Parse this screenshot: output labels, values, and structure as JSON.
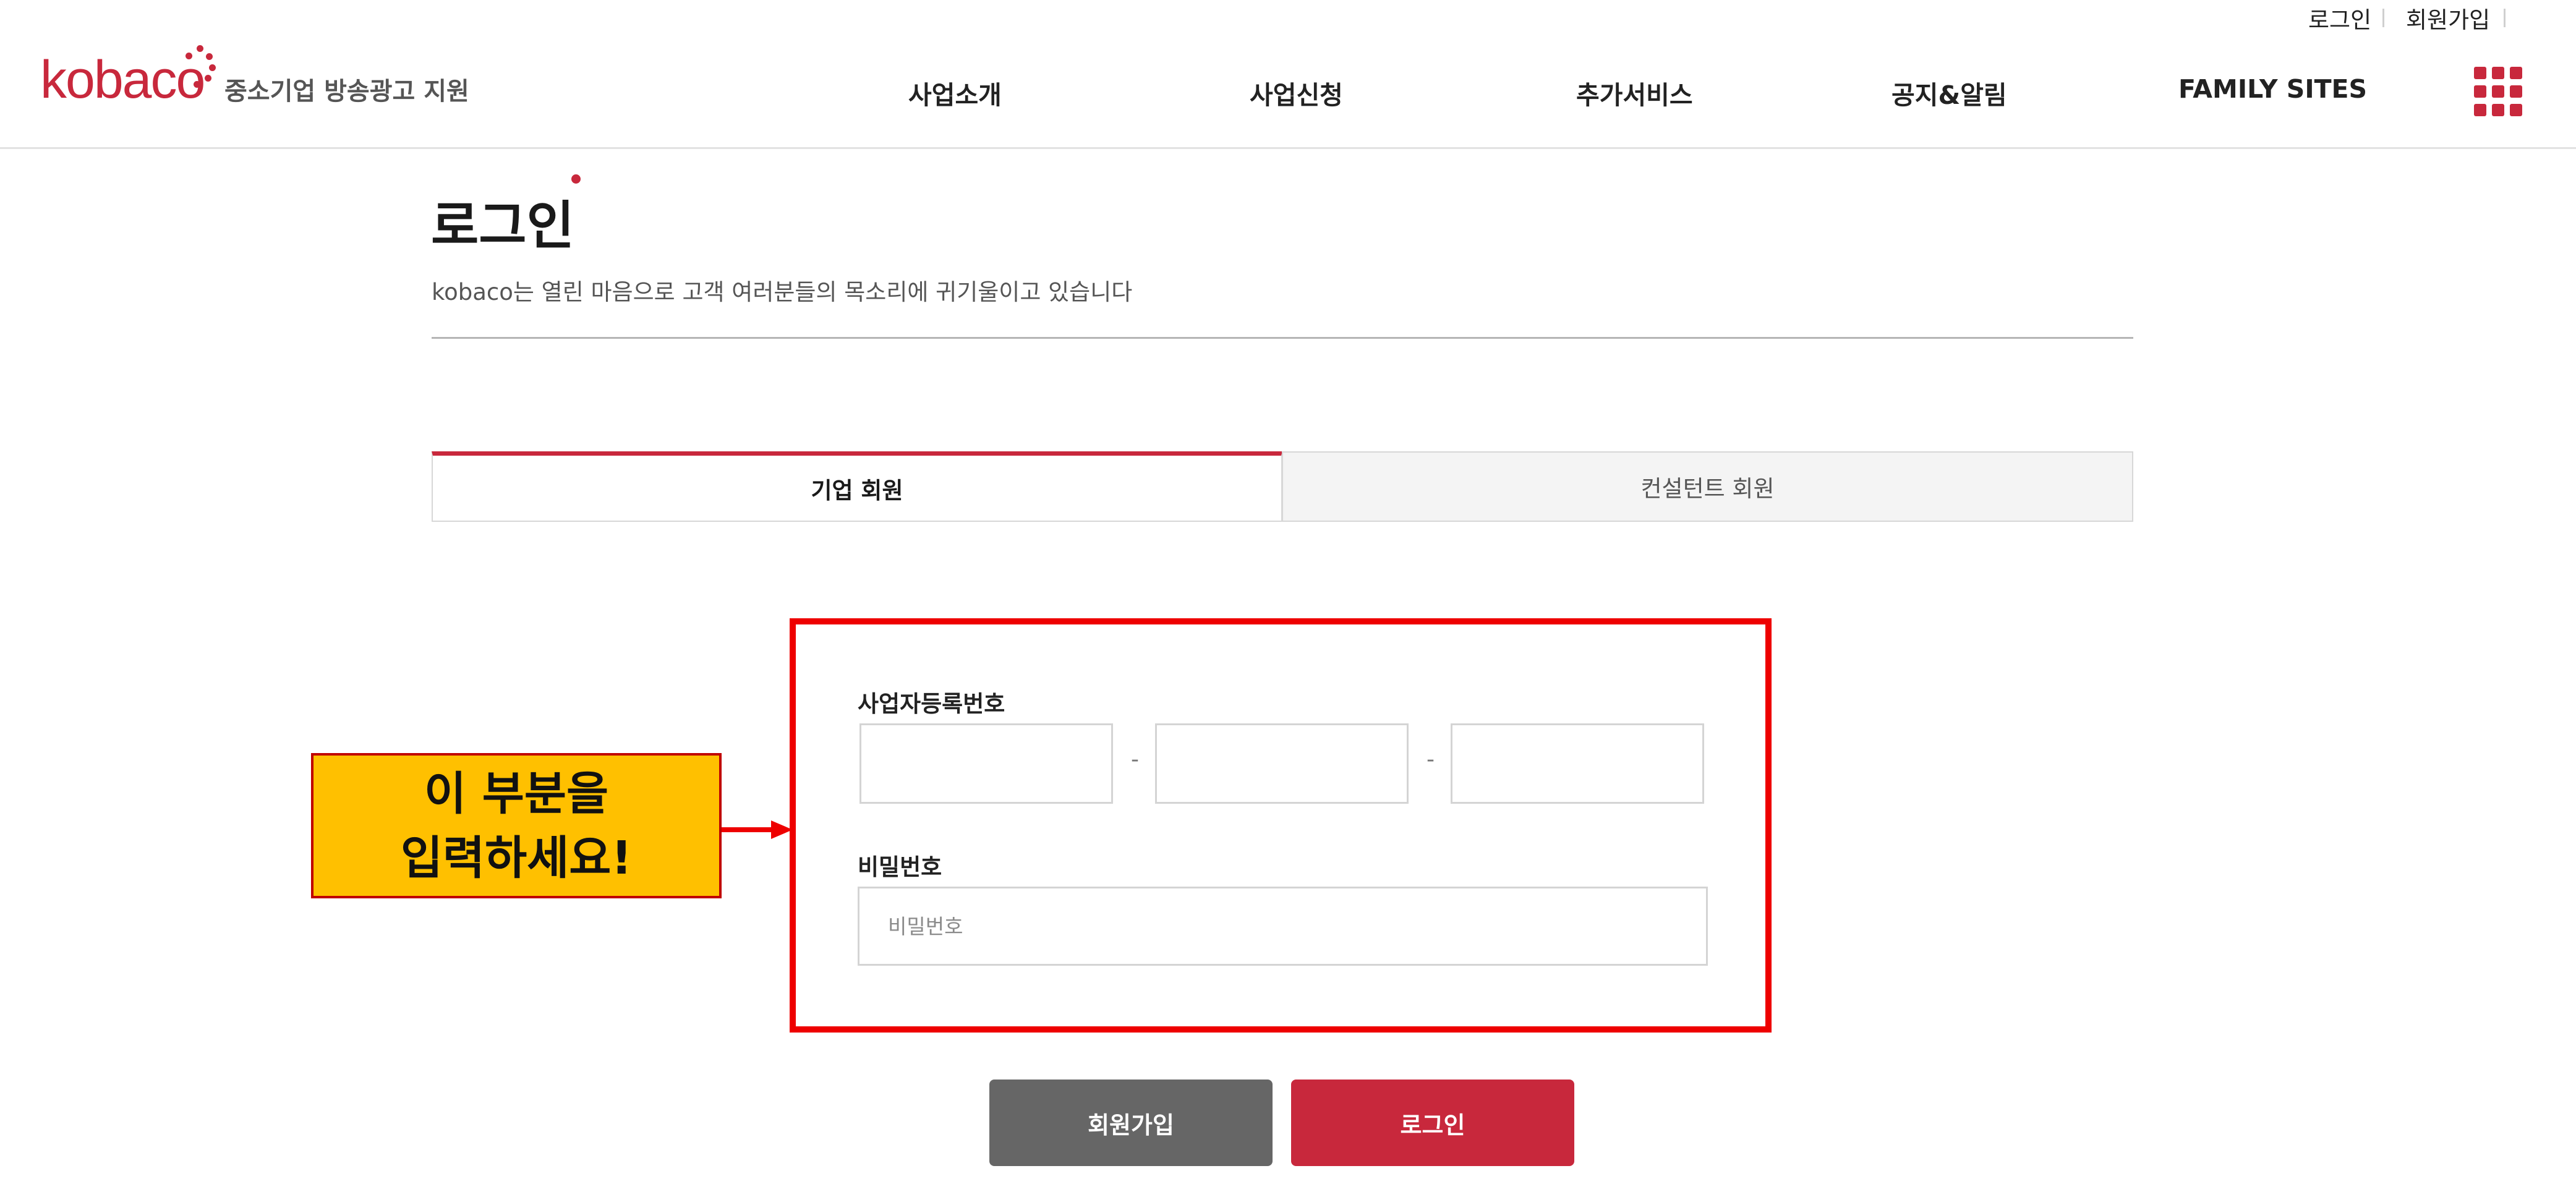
{
  "header": {
    "util_links": {
      "login": "로그인",
      "signup": "회원가입"
    },
    "logo": {
      "word": "kobaco",
      "subtitle": "중소기업 방송광고 지원"
    },
    "nav": [
      "사업소개",
      "사업신청",
      "추가서비스",
      "공지&알림",
      "FAMILY SITES"
    ],
    "menu_icon": "grid-menu-icon"
  },
  "page": {
    "title": "로그인",
    "subtitle": "kobaco는 열린 마음으로 고객 여러분들의 목소리에 귀기울이고 있습니다"
  },
  "tabs": [
    {
      "label": "기업 회원",
      "active": true
    },
    {
      "label": "컨설턴트 회원",
      "active": false
    }
  ],
  "form": {
    "business_number_label": "사업자등록번호",
    "business_number_values": [
      "",
      "",
      ""
    ],
    "dash": "-",
    "password_label": "비밀번호",
    "password_placeholder": "비밀번호",
    "password_value": ""
  },
  "callout": {
    "line1": "이 부분을",
    "line2": "입력하세요!"
  },
  "buttons": {
    "signup": "회원가입",
    "login": "로그인"
  },
  "colors": {
    "brand_red": "#c8283c",
    "highlight_red": "#ee0000",
    "callout_yellow": "#ffc000",
    "signup_gray": "#666666"
  }
}
